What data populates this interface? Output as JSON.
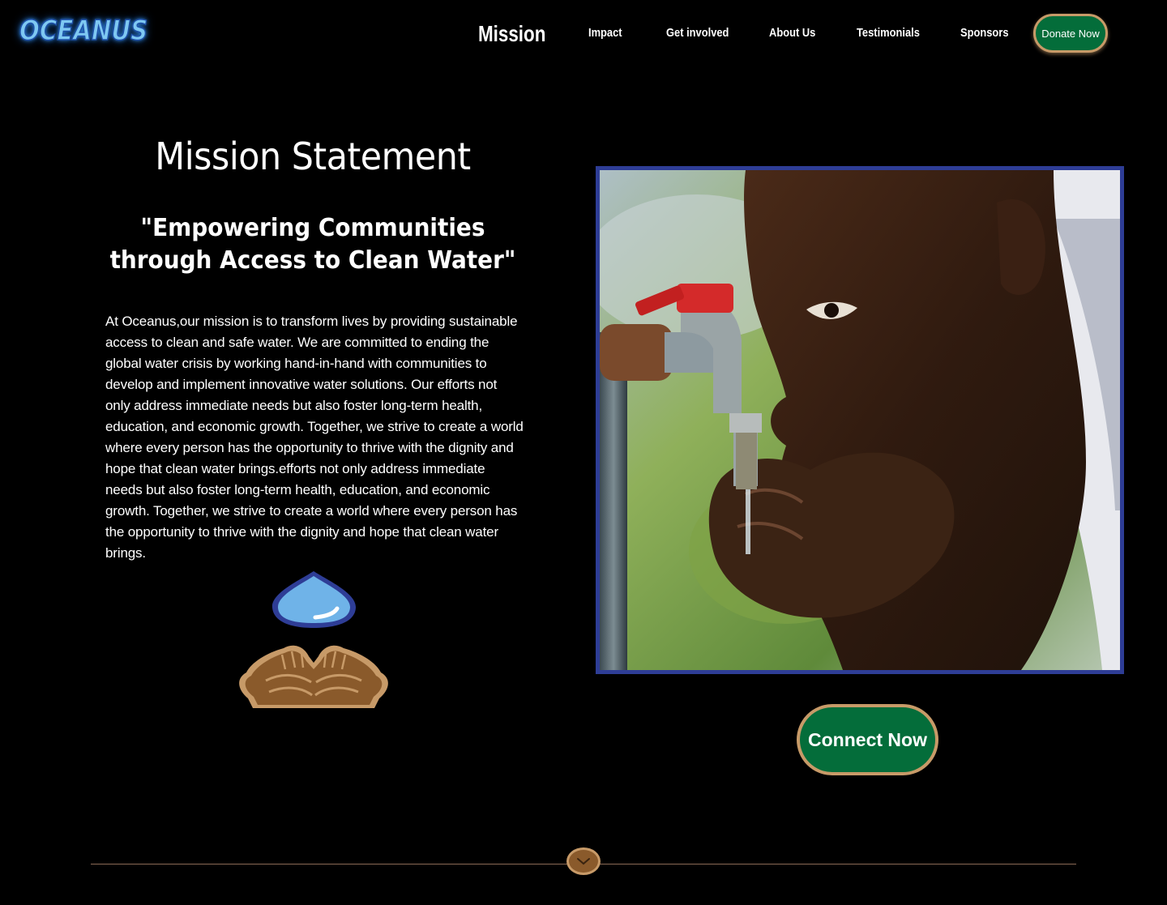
{
  "header": {
    "logo": "OCEANUS",
    "nav": [
      {
        "label": "Mission",
        "active": true
      },
      {
        "label": "Impact",
        "active": false
      },
      {
        "label": "Get involved",
        "active": false
      },
      {
        "label": "About Us",
        "active": false
      },
      {
        "label": "Testimonials",
        "active": false
      },
      {
        "label": "Sponsors",
        "active": false
      }
    ],
    "donate_label": "Donate Now"
  },
  "mission": {
    "title": "Mission Statement",
    "tagline": "\"Empowering Communities through Access to Clean Water\"",
    "body": "At Oceanus,our mission is to transform lives by providing sustainable access to clean and safe water. We are committed to ending the global water crisis by working hand-in-hand with communities to develop and implement innovative water solutions. Our efforts not only address immediate needs but also foster long-term health, education, and economic growth. Together, we strive to create a world where every person has the opportunity to thrive with the dignity and hope that clean water brings.efforts not only address immediate needs but also foster long-term health, education, and economic growth. Together, we strive to create a world where every person has the opportunity to thrive with the dignity and hope that clean water brings."
  },
  "cta": {
    "connect_label": "Connect Now"
  },
  "icons": {
    "drop": "water-drop-icon",
    "hands": "cupped-hands-icon",
    "scroll": "chevron-down-icon"
  },
  "colors": {
    "background": "#000000",
    "button_green": "#046d3a",
    "button_border": "#c79a68",
    "photo_border": "#2e3d96",
    "logo_blue": "#7ec8f2",
    "drop_blue": "#6fb3e8",
    "hands_brown": "#8a5a2b"
  }
}
